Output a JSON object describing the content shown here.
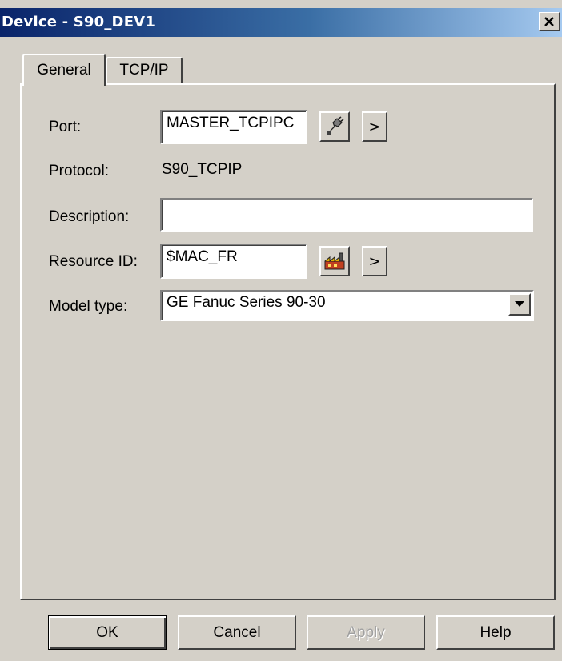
{
  "window": {
    "title": "Device - S90_DEV1"
  },
  "tabs": [
    {
      "label": "General"
    },
    {
      "label": "TCP/IP"
    }
  ],
  "form": {
    "port_label": "Port:",
    "port_value": "MASTER_TCPIPC",
    "protocol_label": "Protocol:",
    "protocol_value": "S90_TCPIP",
    "description_label": "Description:",
    "description_value": "",
    "resource_label": "Resource ID:",
    "resource_value": "$MAC_FR",
    "model_label": "Model type:",
    "model_value": "GE Fanuc Series 90-30",
    "browse_glyph": ">"
  },
  "buttons": {
    "ok": "OK",
    "cancel": "Cancel",
    "apply": "Apply",
    "help": "Help"
  },
  "icons": {
    "close": "close-icon",
    "port_config": "plug-wrench-icon",
    "resource_config": "factory-icon",
    "dropdown": "dropdown-arrow-icon"
  }
}
